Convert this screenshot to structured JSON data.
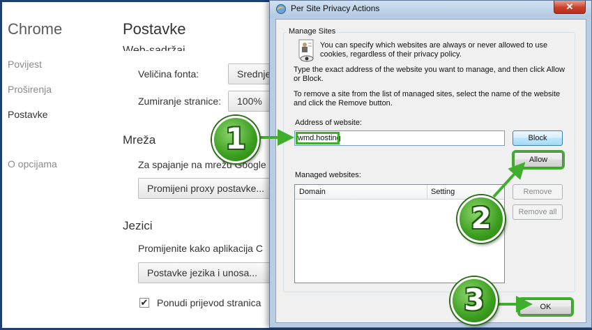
{
  "chrome": {
    "brand": "Chrome",
    "nav": [
      {
        "label": "Povijest"
      },
      {
        "label": "Proširenja"
      },
      {
        "label": "Postavke"
      },
      {
        "label": "O opcijama"
      }
    ],
    "page_title": "Postavke",
    "partial_heading": "Web-sadržaj",
    "font_size_label": "Veličina fonta:",
    "font_size_value": "Srednje",
    "zoom_label": "Zumiranje stranice:",
    "zoom_value": "100%",
    "network_heading": "Mreža",
    "network_text": "Za spajanje na mrežu Google",
    "proxy_button": "Promijeni proxy postavke...",
    "languages_heading": "Jezici",
    "languages_text": "Promijenite kako aplikacija C",
    "language_button": "Postavke jezika i unosa...",
    "translate_checkbox_label": "Ponudi prijevod stranica",
    "translate_checked": true
  },
  "dialog": {
    "title": "Per Site Privacy Actions",
    "close_symbol": "✕",
    "group_title": "Manage Sites",
    "intro_line1": "You can specify which websites are always or never allowed to use",
    "intro_line2": "cookies, regardless of their privacy policy.",
    "instr1_line1": "Type the exact address of the website you want to manage, and then click Allow",
    "instr1_line2": "or Block.",
    "instr2_line1": "To remove a site from the list of managed sites, select the name of the website",
    "instr2_line2": "and click the Remove button.",
    "address_label": "Address of website:",
    "address_value": "wmd.hosting",
    "block_button": "Block",
    "allow_button": "Allow",
    "managed_label": "Managed websites:",
    "columns": [
      "Domain",
      "Setting"
    ],
    "remove_button": "Remove",
    "remove_all_button": "Remove all",
    "ok_button": "OK"
  },
  "callouts": [
    "1",
    "2",
    "3"
  ],
  "colors": {
    "callout_green": "#3fae2c",
    "frame_blue": "#1f3f6e"
  }
}
